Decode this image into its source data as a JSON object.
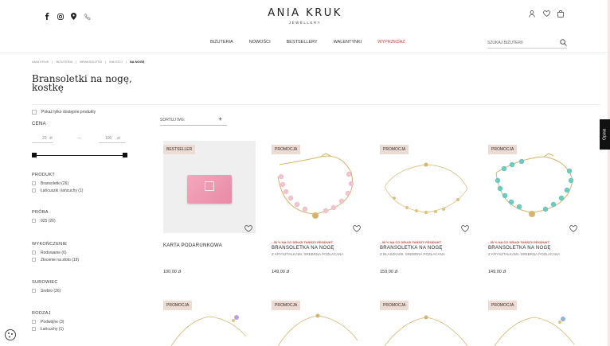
{
  "header": {
    "brand": "ANIA KRUK",
    "brand_sub": "JEWELLERY",
    "social_icons": [
      "facebook-icon",
      "instagram-icon",
      "map-pin-icon",
      "phone-icon"
    ],
    "user_icons": [
      "user-icon",
      "heart-icon",
      "bag-icon"
    ]
  },
  "nav": {
    "items": [
      "BIŻUTERIA",
      "NOWOŚCI",
      "BESTSELLERY",
      "WALENTYNKI",
      "WYPRZEDAŻ"
    ],
    "sale_color": "#c0473e",
    "search_placeholder": "SZUKAJ BIŻUTERII"
  },
  "breadcrumb": [
    "ANIA KRUK",
    "BIŻUTERIA",
    "BRANSOLETKI",
    "MIŁOŚCI",
    "NA NOGĘ"
  ],
  "page_title": "Bransoletki na nogę, kostkę",
  "filters": {
    "available_only": "Pokaż tylko dostępne produkty",
    "price_label": "CENA",
    "price_min": "20",
    "price_max": "100",
    "currency": "zł",
    "price_sep": "—",
    "sections": [
      {
        "title": "PRODUKT",
        "options": [
          "Bransoletki (26)",
          "Łańcuszki i łańcuchy (1)"
        ]
      },
      {
        "title": "PRÓBA",
        "options": [
          "925 (26)"
        ]
      },
      {
        "title": "WYKOŃCZENIE",
        "options": [
          "Rodowanie (6)",
          "Złocenie na złoto (19)"
        ]
      },
      {
        "title": "SUROWIEC",
        "options": [
          "Srebro (26)"
        ]
      },
      {
        "title": "RODZAJ",
        "options": [
          "Podwójne (3)",
          "Łańcuchy (1)"
        ]
      }
    ]
  },
  "sort": {
    "label": "SORTUJ WG:",
    "plus": "+"
  },
  "products": [
    {
      "badge": "BESTSELLER",
      "promo": "",
      "name": "KARTA PODARUNKOWA",
      "sub": "",
      "price": "100,00 zł",
      "image": "gift-card"
    },
    {
      "badge": "PROMOCJA",
      "promo": "- 35 % NA CO DRUGI TAŃSZY PRODUKT",
      "name": "BRANSOLETKA NA NOGĘ",
      "sub": "Z KRYSZTAŁKAMI, SREBRNA POZŁACANA",
      "price": "149,00 zł",
      "image": "pink-beads"
    },
    {
      "badge": "PROMOCJA",
      "promo": "- 35 % NA CO DRUGI TAŃSZY PRODUKT",
      "name": "BRANSOLETKA NA NOGĘ",
      "sub": "Z BLASZKAMI, SREBRNA POZŁACANA",
      "price": "159,00 zł",
      "image": "coins"
    },
    {
      "badge": "PROMOCJA",
      "promo": "- 35 % NA CO DRUGI TAŃSZY PRODUKT",
      "name": "BRANSOLETKA NA NOGĘ",
      "sub": "Z KRYSZTAŁKAMI, SREBRNA POZŁACANA",
      "price": "149,00 zł",
      "image": "turquoise-beads"
    },
    {
      "badge": "PROMOCJA",
      "promo": "",
      "name": "",
      "sub": "",
      "price": "",
      "image": "chain-1"
    },
    {
      "badge": "PROMOCJA",
      "promo": "",
      "name": "",
      "sub": "",
      "price": "",
      "image": "chain-2"
    },
    {
      "badge": "PROMOCJA",
      "promo": "",
      "name": "",
      "sub": "",
      "price": "",
      "image": "chain-3"
    },
    {
      "badge": "PROMOCJA",
      "promo": "",
      "name": "",
      "sub": "",
      "price": "",
      "image": "chain-4"
    }
  ],
  "side_tab": "Opinie",
  "colors": {
    "badge_bg": "#ecdcd6",
    "accent": "#c0473e"
  }
}
